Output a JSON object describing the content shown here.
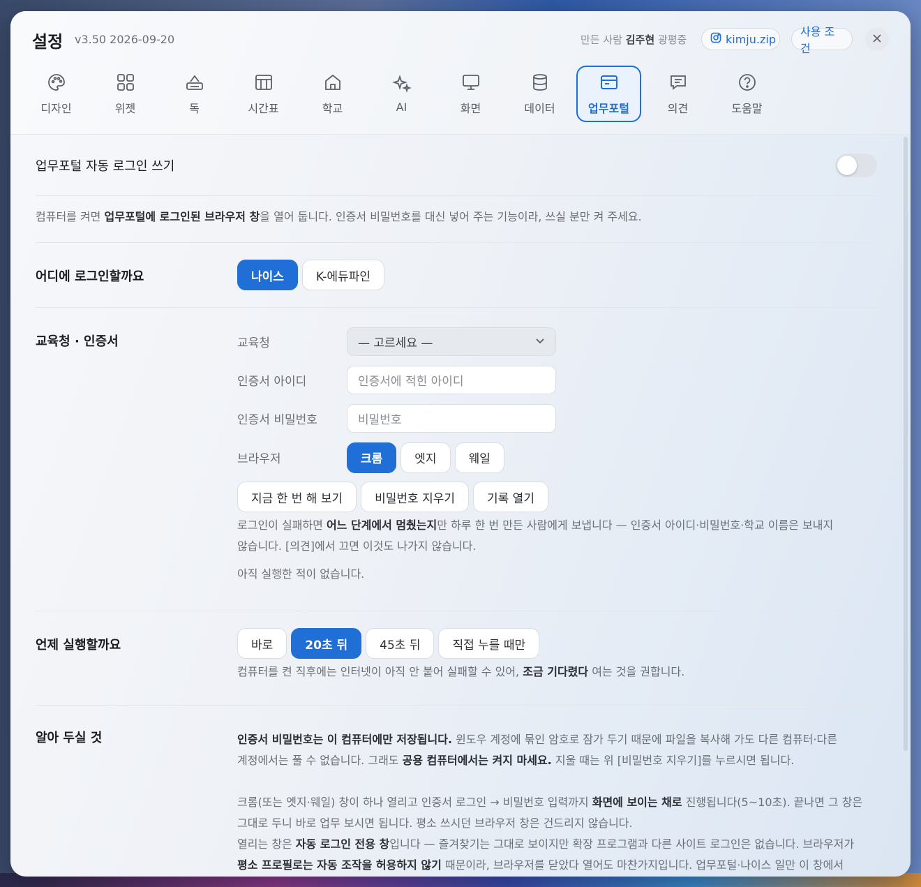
{
  "header": {
    "title": "설정",
    "version": "v3.50 2026-09-20",
    "credit_prefix": "만든 사람",
    "credit_name": "김주현",
    "credit_suffix": "광평중",
    "instagram": "kimju.zip",
    "terms": "사용 조건"
  },
  "tabs": [
    {
      "label": "디자인",
      "icon": "palette-icon"
    },
    {
      "label": "위젯",
      "icon": "grid-icon"
    },
    {
      "label": "독",
      "icon": "dock-icon"
    },
    {
      "label": "시간표",
      "icon": "table-icon"
    },
    {
      "label": "학교",
      "icon": "school-icon"
    },
    {
      "label": "AI",
      "icon": "sparkle-icon"
    },
    {
      "label": "화면",
      "icon": "monitor-icon"
    },
    {
      "label": "데이터",
      "icon": "database-icon"
    },
    {
      "label": "업무포털",
      "icon": "card-icon",
      "active": true
    },
    {
      "label": "의견",
      "icon": "message-icon"
    },
    {
      "label": "도움말",
      "icon": "help-icon"
    }
  ],
  "autologin": {
    "label": "업무포털 자동 로그인 쓰기",
    "enabled": false,
    "desc_1": "컴퓨터를 켜면 ",
    "desc_bold": "업무포털에 로그인된 브라우저 창",
    "desc_2": "을 열어 둡니다. 인증서 비밀번호를 대신 넣어 주는 기능이라, 쓰실 분만 켜 주세요."
  },
  "target": {
    "label": "어디에 로그인할까요",
    "options": [
      "나이스",
      "K-에듀파인"
    ],
    "selected": "나이스"
  },
  "cert": {
    "label": "교육청 · 인증서",
    "office_label": "교육청",
    "office_value": "— 고르세요 —",
    "id_label": "인증서 아이디",
    "id_placeholder": "인증서에 적힌 아이디",
    "pw_label": "인증서 비밀번호",
    "pw_placeholder": "비밀번호",
    "browser_label": "브라우저",
    "browsers": [
      "크롬",
      "엣지",
      "웨일"
    ],
    "browser_selected": "크롬",
    "actions": [
      "지금 한 번 해 보기",
      "비밀번호 지우기",
      "기록 열기"
    ],
    "note_1": "로그인이 실패하면 ",
    "note_bold": "어느 단계에서 멈췄는지",
    "note_2": "만 하루 한 번 만든 사람에게 보냅니다 — 인증서 아이디·비밀번호·학교 이름은 보내지",
    "note_3": "않습니다. [의견]에서 끄면 이것도 나가지 않습니다.",
    "status": "아직 실행한 적이 없습니다."
  },
  "when": {
    "label": "언제 실행할까요",
    "options": [
      "바로",
      "20초 뒤",
      "45초 뒤",
      "직접 누를 때만"
    ],
    "selected": "20초 뒤",
    "note_1": "컴퓨터를 켠 직후에는 인터넷이 아직 안 붙어 실패할 수 있어, ",
    "note_bold": "조금 기다렸다",
    "note_2": " 여는 것을 권합니다."
  },
  "notice": {
    "label": "알아 두실 것",
    "p1_bold1": "인증서 비밀번호는 이 컴퓨터에만 저장됩니다.",
    "p1_text1": " 윈도우 계정에 묶인 암호로 잠가 두기 때문에 파일을 복사해 가도 다른 컴퓨터·다른",
    "p1_text2": "계정에서는 풀 수 없습니다. 그래도 ",
    "p1_bold2": "공용 컴퓨터에서는 켜지 마세요.",
    "p1_text3": " 지울 때는 위 [비밀번호 지우기]를 누르시면 됩니다.",
    "p2_text1": "크롬(또는 엣지·웨일) 창이 하나 열리고 인증서 로그인 → 비밀번호 입력까지 ",
    "p2_bold1": "화면에 보이는 채로",
    "p2_text2": " 진행됩니다(5~10초). 끝나면 그 창은",
    "p2_text3": "그대로 두니 바로 업무 보시면 됩니다. 평소 쓰시던 브라우저 창은 건드리지 않습니다.",
    "p3_text1": "열리는 창은 ",
    "p3_bold1": "자동 로그인 전용 창",
    "p3_text2": "입니다 — 즐겨찾기는 그대로 보이지만 확장 프로그램과 다른 사이트 로그인은 없습니다. 브라우저가",
    "p3_bold2": "평소 프로필로는 자동 조작을 허용하지 않기",
    "p3_text3": " 때문이라, 브라우저를 닫았다 열어도 마찬가지입니다. 업무포털·나이스 일만 이 창에서"
  }
}
